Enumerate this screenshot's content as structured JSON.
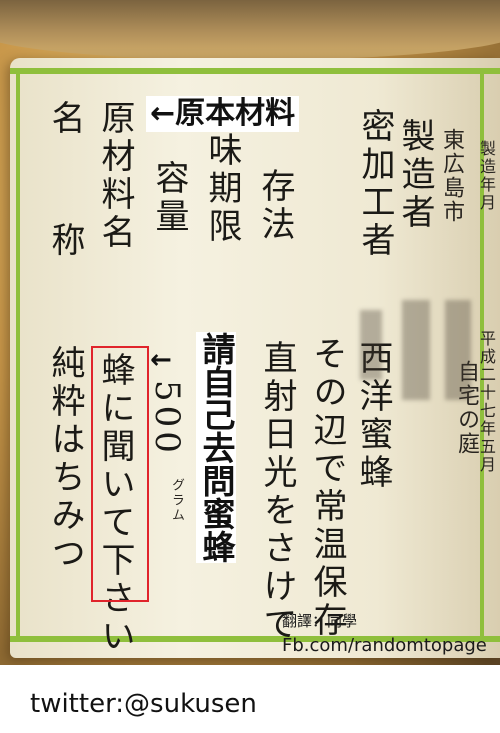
{
  "label": {
    "columns": [
      {
        "id": "manufacture-date-header",
        "text": "製造年月"
      },
      {
        "id": "heisei-date",
        "text": "平成二十七年五月"
      },
      {
        "id": "home-garden",
        "text": "自宅の庭"
      },
      {
        "id": "higashi-hiroshima",
        "text": "東広島市"
      },
      {
        "id": "manufacturer",
        "text": "製造者"
      },
      {
        "id": "beekeeper",
        "text": "密加工者"
      },
      {
        "id": "western-honeybee",
        "text": "西洋蜜蜂"
      },
      {
        "id": "storage-instruction",
        "text": "その辺で常温保存"
      },
      {
        "id": "sunlight-instruction",
        "text": "直射日光をさけて"
      },
      {
        "id": "storage-method",
        "text": "存法"
      },
      {
        "id": "best-before",
        "text": "味期限"
      },
      {
        "id": "content-volume",
        "text": "容量"
      },
      {
        "id": "volume-value",
        "text": "500"
      },
      {
        "id": "grams-unit",
        "text": "グラム"
      },
      {
        "id": "ingredient-name-label",
        "text": "原材料名"
      },
      {
        "id": "ask-the-bees",
        "text": "蜂に聞いて下さい"
      },
      {
        "id": "product-name-label",
        "text": "名称"
      },
      {
        "id": "pure-honey",
        "text": "純粋はちみつ"
      }
    ]
  },
  "annotations": {
    "top_note": "←原本材料",
    "side_arrow": "←",
    "side_note": "請自己去問蜜蜂",
    "translator": "翻譯：同學",
    "source": "Fb.com/randomtopage"
  },
  "caption": "twitter:@sukusen",
  "colors": {
    "honey": "#c8974a",
    "label_paper": "#f2eedb",
    "label_green": "#8fbf3c",
    "highlight_red": "#e0242b"
  }
}
